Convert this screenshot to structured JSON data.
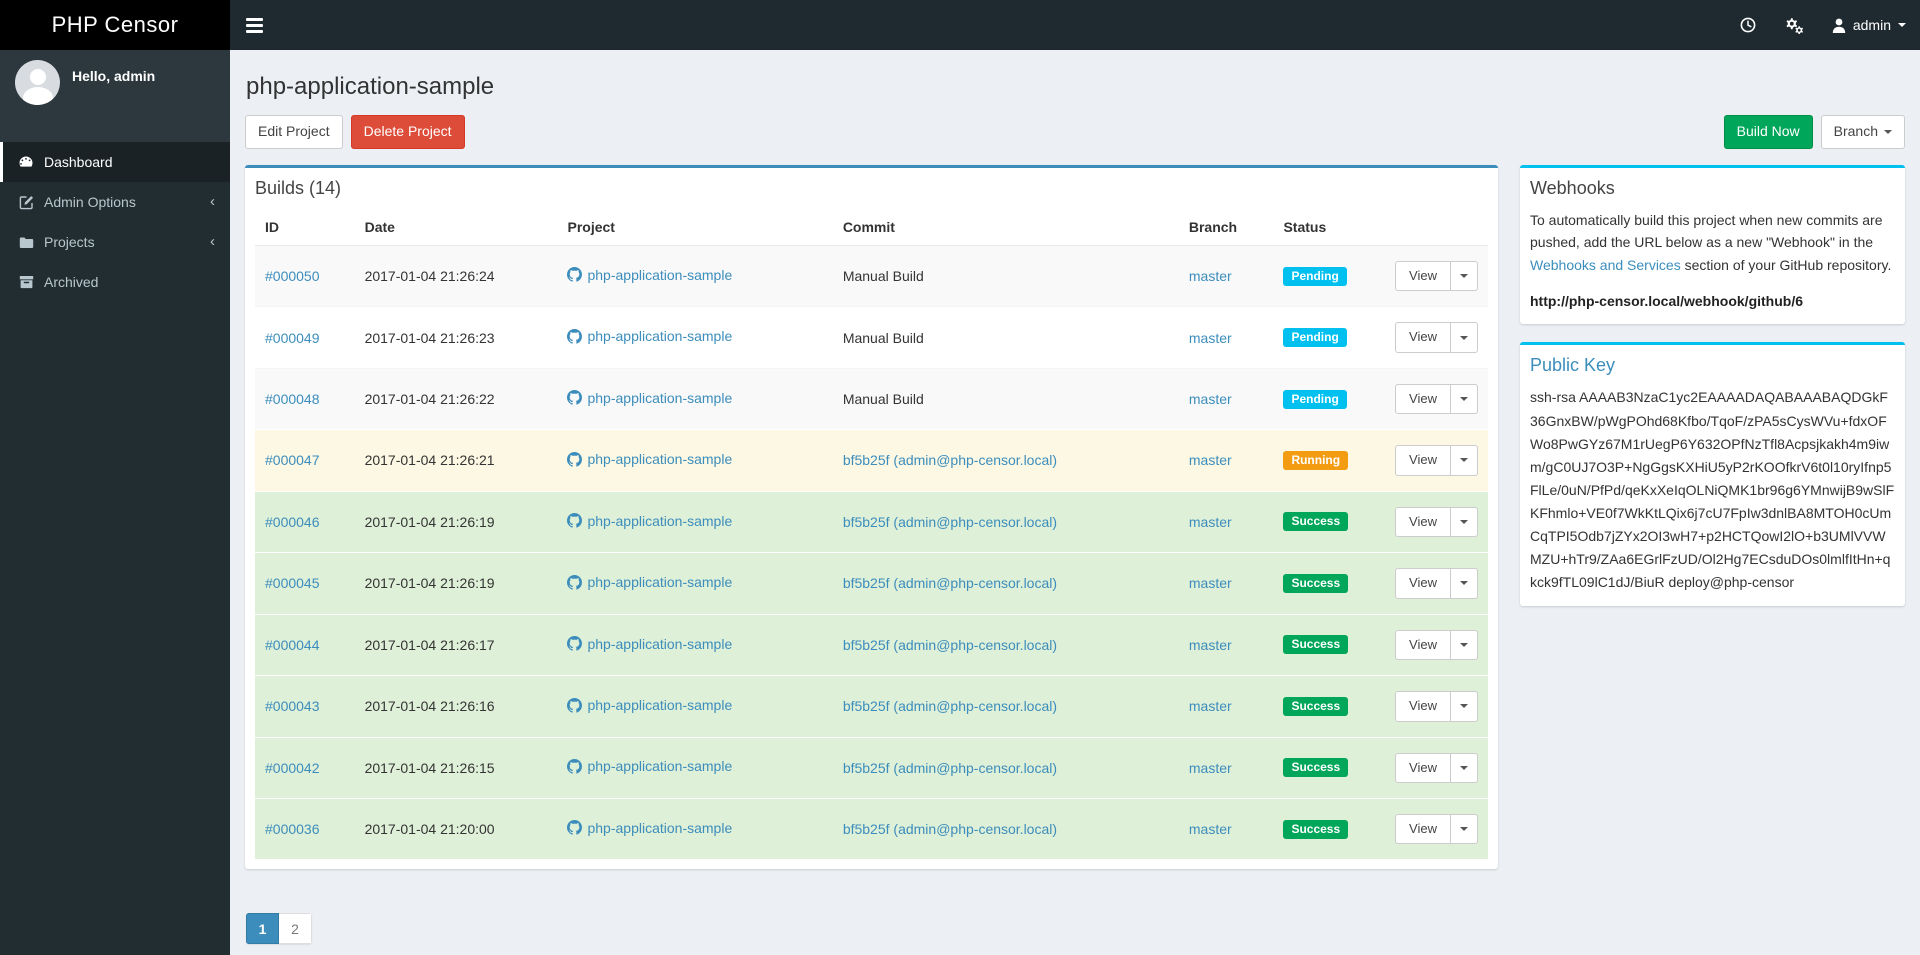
{
  "app": {
    "brand": "PHP Censor"
  },
  "navbar": {
    "user_label": "admin",
    "icons": [
      "clock-icon",
      "cogs-icon",
      "user-icon"
    ]
  },
  "sidebar": {
    "greeting": "Hello, admin",
    "items": [
      {
        "label": "Dashboard",
        "icon": "dashboard-icon",
        "active": true,
        "chevron": false
      },
      {
        "label": "Admin Options",
        "icon": "edit-icon",
        "active": false,
        "chevron": true
      },
      {
        "label": "Projects",
        "icon": "folder-icon",
        "active": false,
        "chevron": true
      },
      {
        "label": "Archived",
        "icon": "archive-icon",
        "active": false,
        "chevron": false
      }
    ]
  },
  "page": {
    "title": "php-application-sample",
    "edit_button": "Edit Project",
    "delete_button": "Delete Project",
    "build_now_button": "Build Now",
    "branch_button": "Branch"
  },
  "builds": {
    "title": "Builds (14)",
    "columns": [
      "ID",
      "Date",
      "Project",
      "Commit",
      "Branch",
      "Status",
      ""
    ],
    "view_label": "View",
    "rows": [
      {
        "id": "#000050",
        "date": "2017-01-04 21:26:24",
        "project": "php-application-sample",
        "commit": "Manual Build",
        "commit_is_link": false,
        "branch": "master",
        "status": "Pending"
      },
      {
        "id": "#000049",
        "date": "2017-01-04 21:26:23",
        "project": "php-application-sample",
        "commit": "Manual Build",
        "commit_is_link": false,
        "branch": "master",
        "status": "Pending"
      },
      {
        "id": "#000048",
        "date": "2017-01-04 21:26:22",
        "project": "php-application-sample",
        "commit": "Manual Build",
        "commit_is_link": false,
        "branch": "master",
        "status": "Pending"
      },
      {
        "id": "#000047",
        "date": "2017-01-04 21:26:21",
        "project": "php-application-sample",
        "commit": "bf5b25f (admin@php-censor.local)",
        "commit_is_link": true,
        "branch": "master",
        "status": "Running"
      },
      {
        "id": "#000046",
        "date": "2017-01-04 21:26:19",
        "project": "php-application-sample",
        "commit": "bf5b25f (admin@php-censor.local)",
        "commit_is_link": true,
        "branch": "master",
        "status": "Success"
      },
      {
        "id": "#000045",
        "date": "2017-01-04 21:26:19",
        "project": "php-application-sample",
        "commit": "bf5b25f (admin@php-censor.local)",
        "commit_is_link": true,
        "branch": "master",
        "status": "Success"
      },
      {
        "id": "#000044",
        "date": "2017-01-04 21:26:17",
        "project": "php-application-sample",
        "commit": "bf5b25f (admin@php-censor.local)",
        "commit_is_link": true,
        "branch": "master",
        "status": "Success"
      },
      {
        "id": "#000043",
        "date": "2017-01-04 21:26:16",
        "project": "php-application-sample",
        "commit": "bf5b25f (admin@php-censor.local)",
        "commit_is_link": true,
        "branch": "master",
        "status": "Success"
      },
      {
        "id": "#000042",
        "date": "2017-01-04 21:26:15",
        "project": "php-application-sample",
        "commit": "bf5b25f (admin@php-censor.local)",
        "commit_is_link": true,
        "branch": "master",
        "status": "Success"
      },
      {
        "id": "#000036",
        "date": "2017-01-04 21:20:00",
        "project": "php-application-sample",
        "commit": "bf5b25f (admin@php-censor.local)",
        "commit_is_link": true,
        "branch": "master",
        "status": "Success"
      }
    ]
  },
  "pagination": {
    "pages": [
      "1",
      "2"
    ],
    "active": "1"
  },
  "webhooks": {
    "title": "Webhooks",
    "text_before_link": "To automatically build this project when new commits are pushed, add the URL below as a new \"Webhook\" in the ",
    "link_text": "Webhooks and Services",
    "text_after_link": " section of your GitHub repository.",
    "url": "http://php-censor.local/webhook/github/6"
  },
  "public_key": {
    "title": "Public Key",
    "key": "ssh-rsa AAAAB3NzaC1yc2EAAAADAQABAAABAQDGkF36GnxBW/pWgPOhd68Kfbo/TqoF/zPA5sCysWVu+fdxOFWo8PwGYz67M1rUegP6Y632OPfNzTfl8Acpsjkakh4m9iwm/gC0UJ7O3P+NgGgsKXHiU5yP2rKOOfkrV6t0l10ryIfnp5FlLe/0uN/PfPd/qeKxXeIqOLNiQMK1br96g6YMnwijB9wSlFKFhmlo+VE0f7WkKtLQix6j7cU7FpIw3dnlBA8MTOH0cUmCqTPI5Odb7jZYx2OI3wH7+p2HCTQowI2lO+b3UMlVVWMZU+hTr9/ZAa6EGrlFzUD/Ol2Hg7ECsduDOs0lmlfItHn+qkck9fTL09lC1dJ/BiuR deploy@php-censor"
  },
  "colors": {
    "accent_blue": "#3c8dbc",
    "panel_top_primary": "#3c8dbc",
    "panel_top_info": "#00c0ef",
    "build_now_green": "#00a65a",
    "delete_red": "#dd4b39",
    "sidebar_dark": "#222d32",
    "status": {
      "Pending": "#00c0ef",
      "Running": "#f39c12",
      "Success": "#00a65a"
    }
  }
}
